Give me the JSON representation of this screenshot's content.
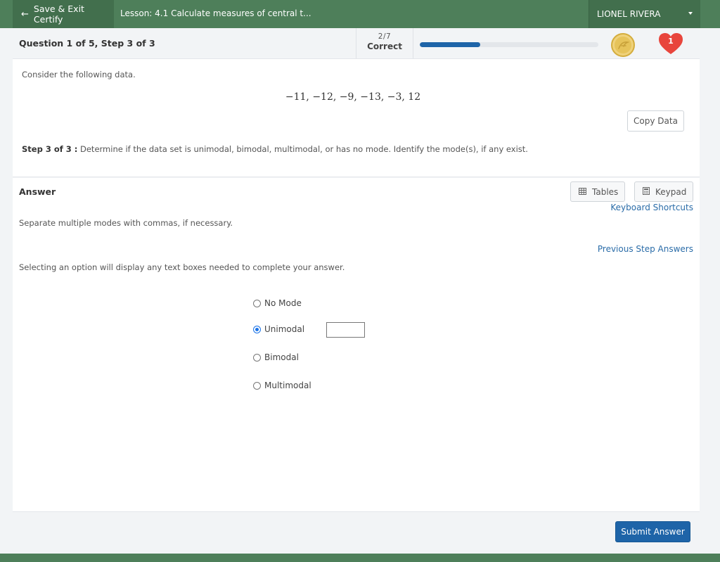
{
  "topbar": {
    "save_exit_label": "Save & Exit Certify",
    "lesson_title": "Lesson: 4.1 Calculate measures of central t...",
    "user_name": "LIONEL RIVERA"
  },
  "question_header": {
    "title": "Question 1 of 5, Step 3 of 3",
    "score_fraction": "2/7",
    "score_label": "Correct",
    "progress_fraction": 0.34,
    "lives": "1",
    "colors": {
      "progress": "#1e64a8",
      "heart": "#e8453c",
      "coin": "#e6c35a"
    }
  },
  "problem": {
    "intro": "Consider the following data.",
    "data_values": "−11, −12, −9, −13, −3, 12",
    "copy_data_label": "Copy Data",
    "step_label": "Step 3 of 3 :",
    "step_text": "Determine if the data set is unimodal, bimodal, multimodal, or has no mode. Identify the mode(s), if any exist."
  },
  "answer": {
    "title": "Answer",
    "tables_label": "Tables",
    "keypad_label": "Keypad",
    "keyboard_shortcuts_label": "Keyboard Shortcuts",
    "hint_separate": "Separate multiple modes with commas, if necessary.",
    "previous_step_answers_label": "Previous Step Answers",
    "hint_selecting": "Selecting an option will display any text boxes needed to complete your answer.",
    "options": [
      {
        "label": "No Mode",
        "checked": false
      },
      {
        "label": "Unimodal",
        "checked": true
      },
      {
        "label": "Bimodal",
        "checked": false
      },
      {
        "label": "Multimodal",
        "checked": false
      }
    ],
    "unimodal_value": ""
  },
  "footer": {
    "submit_label": "Submit Answer"
  }
}
